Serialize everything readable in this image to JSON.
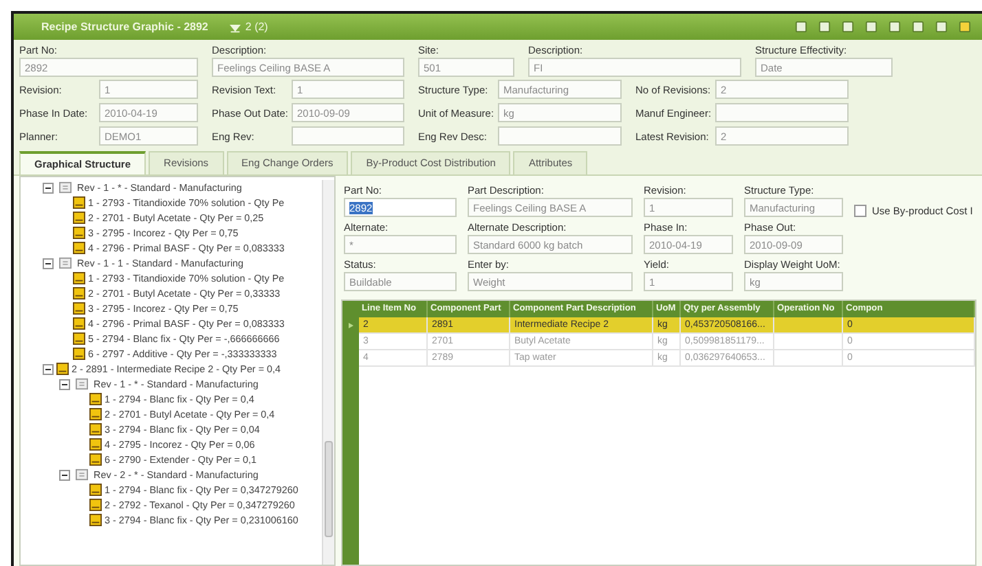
{
  "window": {
    "title": "Recipe Structure Graphic - 2892",
    "subtitle": "2 (2)"
  },
  "header": {
    "top_fields": [
      {
        "label": "Part No:",
        "value": "2892"
      },
      {
        "label": "Description:",
        "value": "Feelings Ceiling BASE A"
      },
      {
        "label": "Site:",
        "value": "501"
      },
      {
        "label": "Description:",
        "value": "FI"
      },
      {
        "label": "Structure Effectivity:",
        "value": "Date"
      }
    ],
    "rows": [
      [
        {
          "label": "Revision:",
          "value": "1"
        },
        {
          "label": "Revision Text:",
          "value": "1"
        },
        {
          "label": "Structure Type:",
          "value": "Manufacturing"
        },
        {
          "label": "No of Revisions:",
          "value": "2"
        }
      ],
      [
        {
          "label": "Phase In Date:",
          "value": "2010-04-19"
        },
        {
          "label": "Phase Out Date:",
          "value": "2010-09-09"
        },
        {
          "label": "Unit of Measure:",
          "value": "kg"
        },
        {
          "label": "Manuf Engineer:"
        }
      ],
      [
        {
          "label": "Planner:",
          "value": "DEMO1"
        },
        {
          "label": "Eng Rev:"
        },
        {
          "label": "Eng Rev Desc:"
        },
        {
          "label": "Latest Revision:",
          "value": "2"
        }
      ]
    ]
  },
  "tabs": [
    {
      "label": "Graphical Structure",
      "selected": true
    },
    {
      "label": "Revisions",
      "selected": false
    },
    {
      "label": "Eng Change Orders",
      "selected": false
    },
    {
      "label": "By-Product Cost Distribution",
      "selected": false
    },
    {
      "label": "Attributes",
      "selected": false
    }
  ],
  "tree": [
    {
      "kind": "revision",
      "label": "Rev - 1 - * - Standard - Manufacturing",
      "expanded": true,
      "children": [
        {
          "kind": "part",
          "label": "1 - 2793 - Titandioxide 70% solution - Qty Pe"
        },
        {
          "kind": "part",
          "label": "2 - 2701 - Butyl Acetate - Qty Per = 0,25"
        },
        {
          "kind": "part",
          "label": "3 - 2795 - Incorez - Qty Per = 0,75"
        },
        {
          "kind": "part",
          "label": "4 - 2796 - Primal BASF - Qty Per = 0,083333"
        }
      ]
    },
    {
      "kind": "revision",
      "label": "Rev - 1 - 1 - Standard - Manufacturing",
      "expanded": true,
      "children": [
        {
          "kind": "part",
          "label": "1 - 2793 - Titandioxide 70% solution - Qty Pe"
        },
        {
          "kind": "part",
          "label": "2 - 2701 - Butyl Acetate - Qty Per = 0,33333"
        },
        {
          "kind": "part",
          "label": "3 - 2795 - Incorez - Qty Per = 0,75"
        },
        {
          "kind": "part",
          "label": "4 - 2796 - Primal BASF - Qty Per = 0,083333"
        },
        {
          "kind": "part",
          "label": "5 - 2794 - Blanc fix - Qty Per = -,666666666"
        },
        {
          "kind": "part",
          "label": "6 - 2797 - Additive - Qty Per = -,333333333"
        }
      ]
    },
    {
      "kind": "part",
      "label": "2 - 2891 - Intermediate Recipe 2 - Qty Per = 0,4",
      "expanded": true,
      "children": [
        {
          "kind": "revision",
          "label": "Rev - 1 - * - Standard - Manufacturing",
          "expanded": true,
          "children": [
            {
              "kind": "part",
              "label": "1 - 2794 - Blanc fix - Qty Per = 0,4"
            },
            {
              "kind": "part",
              "label": "2 - 2701 - Butyl Acetate - Qty Per = 0,4"
            },
            {
              "kind": "part",
              "label": "3 - 2794 - Blanc fix - Qty Per = 0,04"
            },
            {
              "kind": "part",
              "label": "4 - 2795 - Incorez - Qty Per = 0,06"
            },
            {
              "kind": "part",
              "label": "6 - 2790 - Extender - Qty Per = 0,1"
            }
          ]
        },
        {
          "kind": "revision",
          "label": "Rev - 2 - * - Standard - Manufacturing",
          "expanded": true,
          "children": [
            {
              "kind": "part",
              "label": "1 - 2794 - Blanc fix - Qty Per = 0,347279260"
            },
            {
              "kind": "part",
              "label": "2 - 2792 - Texanol - Qty Per = 0,347279260"
            },
            {
              "kind": "part",
              "label": "3 - 2794 - Blanc fix - Qty Per = 0,231006160"
            }
          ]
        }
      ]
    }
  ],
  "detail": {
    "rows": [
      [
        {
          "label": "Part No:",
          "value": "2892",
          "selected": true
        },
        {
          "label": "Part Description:",
          "value": "Feelings Ceiling BASE A",
          "selected": false
        },
        {
          "label": "Revision:",
          "value": "1",
          "selected": false
        },
        {
          "label": "Structure Type:",
          "value": "Manufacturing",
          "selected": false
        }
      ],
      [
        {
          "label": "Alternate:",
          "value": "*",
          "selected": false
        },
        {
          "label": "Alternate Description:",
          "value": "Standard 6000 kg batch",
          "selected": false
        },
        {
          "label": "Phase In:",
          "value": "2010-04-19",
          "selected": false
        },
        {
          "label": "Phase Out:",
          "value": "2010-09-09",
          "selected": false
        }
      ],
      [
        {
          "label": "Status:",
          "value": "Buildable",
          "selected": false
        },
        {
          "label": "Enter by:",
          "value": "Weight",
          "selected": false
        },
        {
          "label": "Yield:",
          "value": "1",
          "selected": false
        },
        {
          "label": "Display Weight UoM:",
          "value": "kg",
          "selected": false
        }
      ]
    ],
    "checkbox": {
      "label": "Use By-product Cost I",
      "checked": false
    }
  },
  "table": {
    "columns": [
      "Line Item No",
      "Component Part",
      "Component Part Description",
      "UoM",
      "Qty per Assembly",
      "Operation No",
      "Compon"
    ],
    "rows": [
      {
        "selected": true,
        "cells": [
          "2",
          "2891",
          "Intermediate Recipe 2",
          "kg",
          "0,453720508166...",
          null,
          "0"
        ]
      },
      {
        "selected": false,
        "cells": [
          "3",
          "2701",
          "Butyl Acetate",
          "kg",
          "0,509981851179...",
          null,
          "0"
        ]
      },
      {
        "selected": false,
        "cells": [
          "4",
          "2789",
          "Tap water",
          "kg",
          "0,036297640653...",
          null,
          "0"
        ]
      }
    ]
  }
}
